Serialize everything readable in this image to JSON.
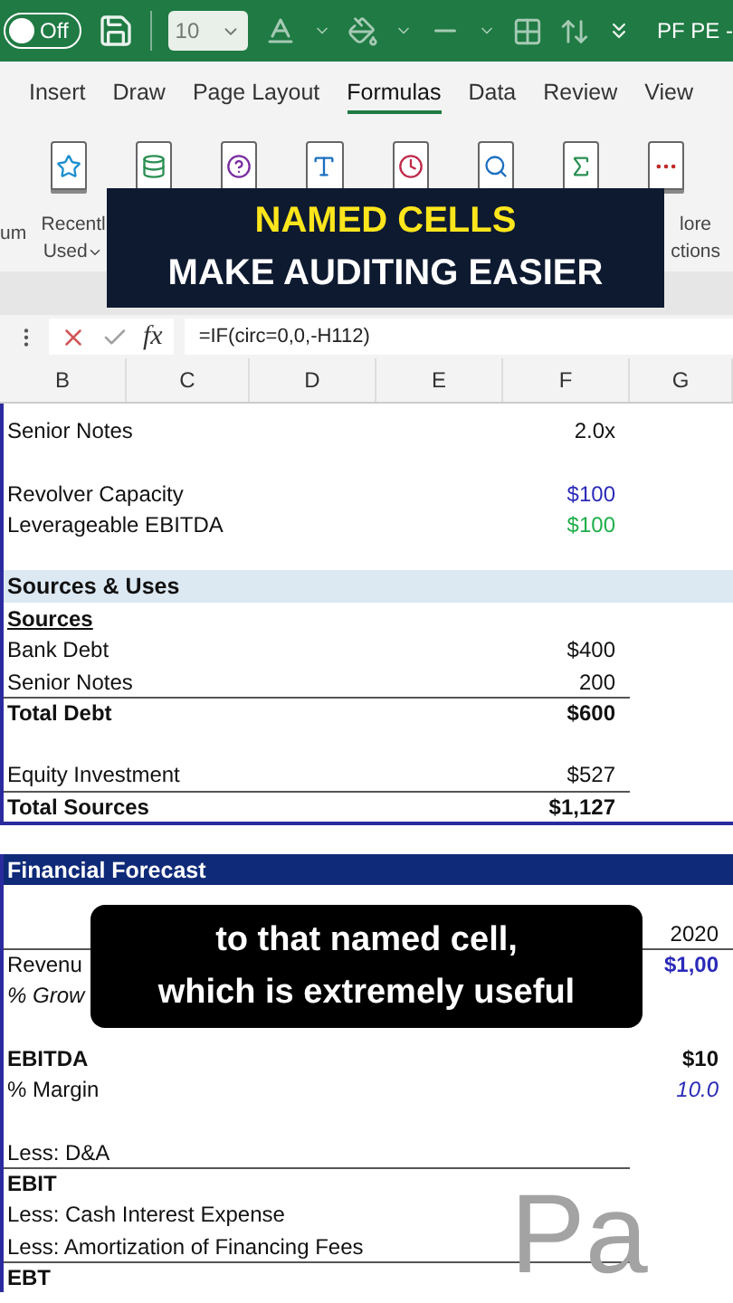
{
  "toolbar": {
    "autosave": {
      "label": "Off",
      "on": false
    },
    "font_size": "10",
    "title": "PF PE -"
  },
  "tabs": [
    {
      "label": "Insert",
      "selected": false
    },
    {
      "label": "Draw",
      "selected": false
    },
    {
      "label": "Page Layout",
      "selected": false
    },
    {
      "label": "Formulas",
      "selected": true
    },
    {
      "label": "Data",
      "selected": false
    },
    {
      "label": "Review",
      "selected": false
    },
    {
      "label": "View",
      "selected": false
    }
  ],
  "ribbon": {
    "left_label": "um",
    "recent": [
      "Recentl",
      "Used"
    ],
    "more": [
      "lore",
      "ctions"
    ]
  },
  "formula_bar": {
    "fx": "fx",
    "formula": "=IF(circ=0,0,-H112)"
  },
  "columns": [
    "B",
    "C",
    "D",
    "E",
    "F",
    "G"
  ],
  "sections": [
    {
      "kind": "summary",
      "rows": [
        {
          "kind": "item",
          "label": "Senior Notes",
          "value": "2.0x",
          "rule_above": false
        },
        {
          "kind": "blank"
        },
        {
          "kind": "item",
          "label": "Revolver Capacity",
          "value": "$100",
          "rule_above": false,
          "color": "#2a2ab8"
        },
        {
          "kind": "item",
          "label": "Leverageable EBITDA",
          "value": "$100",
          "rule_above": false,
          "color": "#1fae4a"
        },
        {
          "kind": "blank"
        },
        {
          "kind": "band",
          "label": "Sources & Uses",
          "color": "#dce8f2"
        },
        {
          "kind": "subheading",
          "label": "Sources",
          "rule_above": false
        },
        {
          "kind": "item",
          "label": "Bank Debt",
          "value": "$400",
          "rule_above": false
        },
        {
          "kind": "item",
          "label": "Senior Notes",
          "value": "200",
          "rule_above": false
        },
        {
          "kind": "total",
          "label": "Total Debt",
          "value": "$600",
          "rule_above": true
        },
        {
          "kind": "blank"
        },
        {
          "kind": "item",
          "label": "Equity Investment",
          "value": "$527",
          "rule_above": false
        },
        {
          "kind": "total",
          "label": "Total Sources",
          "value": "$1,127",
          "rule_above": true
        }
      ]
    },
    {
      "kind": "forecast",
      "rows": [
        {
          "kind": "band",
          "label": "Financial Forecast",
          "color": "#0f2a78"
        },
        {
          "kind": "blank"
        },
        {
          "kind": "item",
          "label": "",
          "value": "2020",
          "rule_above": false
        },
        {
          "kind": "revenue",
          "label": "Revenu",
          "value": "$1,00",
          "rule_above": true,
          "color": "#2a2ab8"
        },
        {
          "kind": "growth",
          "label": "% Grow",
          "rule_above": false
        },
        {
          "kind": "blank"
        },
        {
          "kind": "total",
          "label": "EBITDA",
          "value": "$10",
          "rule_above": false
        },
        {
          "kind": "margin",
          "label": "% Margin",
          "value": "10.0",
          "rule_above": false,
          "color": "#2a2ab8"
        },
        {
          "kind": "blank"
        },
        {
          "kind": "item",
          "label": "Less: D&A",
          "rule_above": false
        },
        {
          "kind": "total",
          "label": "EBIT",
          "rule_above": true
        },
        {
          "kind": "item",
          "label": "Less: Cash Interest Expense",
          "rule_above": false
        },
        {
          "kind": "item",
          "label": "Less: Amortization of Financing Fees",
          "rule_above": false
        },
        {
          "kind": "total",
          "label": "EBT",
          "rule_above": true
        }
      ]
    }
  ],
  "page_label": "Pa",
  "captions": [
    {
      "kind": "title",
      "lines": [
        {
          "text": "NAMED CELLS",
          "color": "#ffe61c"
        },
        {
          "text": "MAKE AUDITING EASIER",
          "color": "#ffffff"
        }
      ]
    },
    {
      "kind": "subtitle",
      "lines": [
        {
          "text": "to that named cell,",
          "color": "#ffffff"
        },
        {
          "text": "which is extremely useful",
          "color": "#ffffff"
        }
      ]
    }
  ]
}
